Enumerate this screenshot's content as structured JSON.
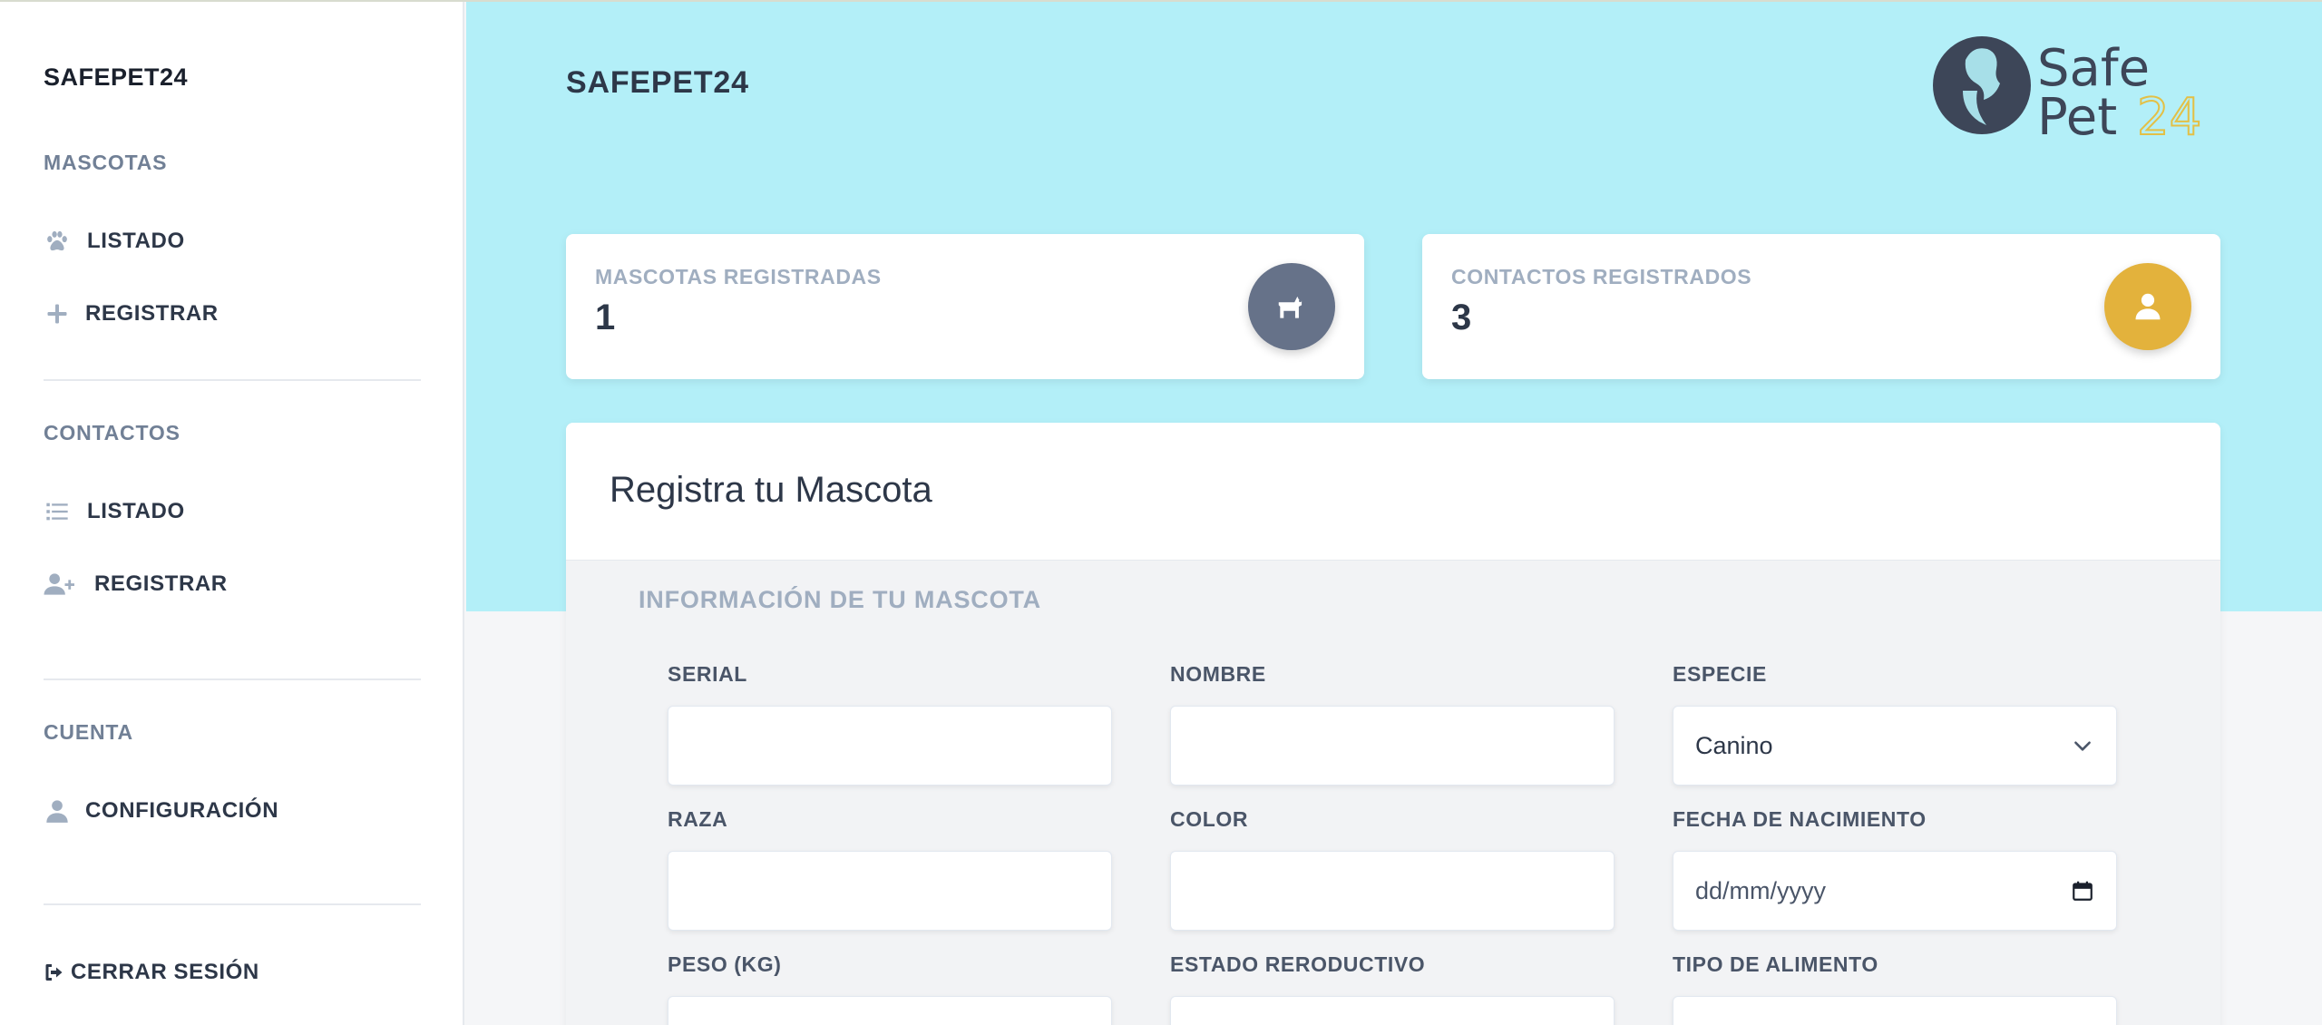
{
  "app": {
    "brand": "SAFEPET24"
  },
  "sidebar": {
    "sections": [
      {
        "title": "MASCOTAS",
        "items": [
          {
            "label": "LISTADO",
            "icon": "paw-icon"
          },
          {
            "label": "REGISTRAR",
            "icon": "plus-icon"
          }
        ]
      },
      {
        "title": "CONTACTOS",
        "items": [
          {
            "label": "LISTADO",
            "icon": "list-icon"
          },
          {
            "label": "REGISTRAR",
            "icon": "user-plus-icon"
          }
        ]
      },
      {
        "title": "CUENTA",
        "items": [
          {
            "label": "CONFIGURACIÓN",
            "icon": "user-icon"
          }
        ]
      }
    ],
    "logout_label": "CERRAR SESIÓN"
  },
  "header": {
    "title": "SAFEPET24",
    "logo": {
      "line1": "Safe",
      "line2_a": "Pet",
      "line2_b": "24"
    }
  },
  "stats": [
    {
      "label": "MASCOTAS REGISTRADAS",
      "value": "1",
      "icon": "dog-icon",
      "icon_bg": "#667289"
    },
    {
      "label": "CONTACTOS REGISTRADOS",
      "value": "3",
      "icon": "user-icon",
      "icon_bg": "#e3b23c"
    }
  ],
  "form": {
    "title": "Registra tu Mascota",
    "section": "INFORMACIÓN DE TU MASCOTA",
    "fields": {
      "serial": {
        "label": "SERIAL",
        "value": ""
      },
      "nombre": {
        "label": "NOMBRE",
        "value": ""
      },
      "especie": {
        "label": "ESPECIE",
        "value": "Canino"
      },
      "raza": {
        "label": "RAZA",
        "value": ""
      },
      "color": {
        "label": "COLOR",
        "value": ""
      },
      "fecha": {
        "label": "FECHA DE NACIMIENTO",
        "placeholder": "dd/mm/yyyy"
      },
      "peso": {
        "label": "PESO (KG)",
        "value": ""
      },
      "estado": {
        "label": "ESTADO RERODUCTIVO",
        "value": ""
      },
      "alimento": {
        "label": "TIPO DE ALIMENTO",
        "value": ""
      }
    }
  },
  "colors": {
    "accent_bg": "#b3eff8",
    "logo_dark": "#3d4658",
    "logo_gold": "#e3c046"
  }
}
